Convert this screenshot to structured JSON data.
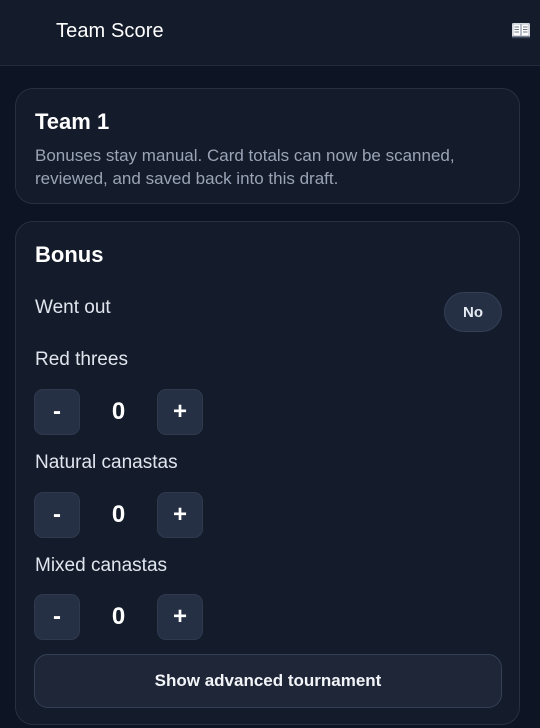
{
  "header": {
    "title": "Team Score",
    "icon": "open-book-icon"
  },
  "team_card": {
    "title": "Team 1",
    "description": "Bonuses stay manual. Card totals can now be scanned, reviewed, and saved back into this draft."
  },
  "bonus_card": {
    "title": "Bonus",
    "went_out": {
      "label": "Went out",
      "value": "No"
    },
    "red_threes": {
      "label": "Red threes",
      "value": "0"
    },
    "natural_canastas": {
      "label": "Natural canastas",
      "value": "0"
    },
    "mixed_canastas": {
      "label": "Mixed canastas",
      "value": "0"
    },
    "stepper": {
      "minus": "-",
      "plus": "+"
    },
    "advanced_button": "Show advanced tournament"
  }
}
